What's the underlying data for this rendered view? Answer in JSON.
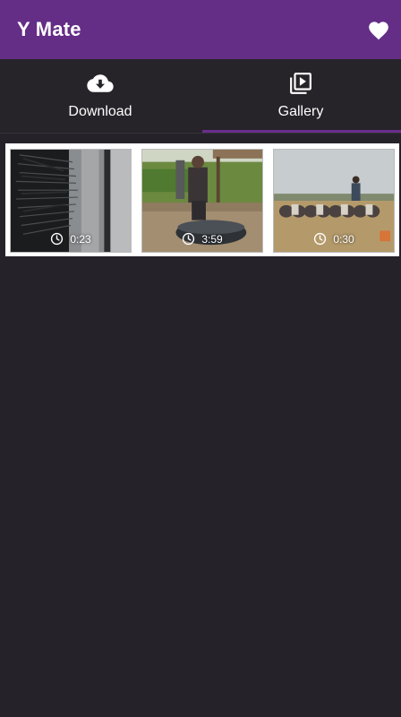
{
  "app": {
    "title": "Y Mate"
  },
  "icons": {
    "favorite": "heart-icon",
    "download": "cloud-download-icon",
    "gallery": "video-library-icon",
    "duration": "clock-icon"
  },
  "colors": {
    "appbar": "#642d86",
    "background": "#252329",
    "tab_indicator": "#6a2e8c",
    "text": "#ffffff"
  },
  "tabs": [
    {
      "label": "Download",
      "selected": false
    },
    {
      "label": "Gallery",
      "selected": true
    }
  ],
  "gallery": {
    "videos": [
      {
        "duration": "0:23"
      },
      {
        "duration": "3:59"
      },
      {
        "duration": "0:30"
      }
    ]
  }
}
